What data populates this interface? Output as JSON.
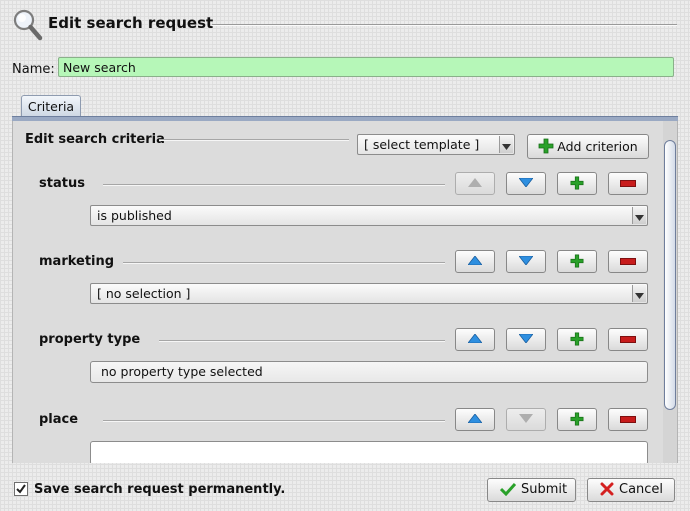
{
  "header": {
    "title": "Edit search request",
    "icon": "magnifier-icon"
  },
  "name_field": {
    "label": "Name:",
    "value": "New search",
    "background": "#b6f7b8"
  },
  "tabs": [
    {
      "label": "Criteria",
      "selected": true
    }
  ],
  "criteria_panel": {
    "heading": "Edit search criteria",
    "template_select": {
      "value": "[ select template ]"
    },
    "add_button_label": "Add criterion"
  },
  "criteria": [
    {
      "label": "status",
      "value": "is published",
      "control": "dropdown",
      "move_up_enabled": false,
      "move_down_enabled": true
    },
    {
      "label": "marketing",
      "value": "[ no selection ]",
      "control": "dropdown",
      "move_up_enabled": true,
      "move_down_enabled": true
    },
    {
      "label": "property type",
      "value": "no property type selected",
      "control": "button",
      "move_up_enabled": true,
      "move_down_enabled": true
    },
    {
      "label": "place",
      "value": "",
      "control": "text",
      "move_up_enabled": true,
      "move_down_enabled": false
    }
  ],
  "footer": {
    "save_permanently_label": "Save search request permanently.",
    "save_permanently_checked": true,
    "submit_label": "Submit",
    "cancel_label": "Cancel"
  },
  "colors": {
    "up_down_arrow": "#2e8fe0",
    "add": "#2aa12a",
    "remove": "#c81c1c",
    "cancel_x": "#d42020",
    "submit_check": "#2aa12a"
  }
}
